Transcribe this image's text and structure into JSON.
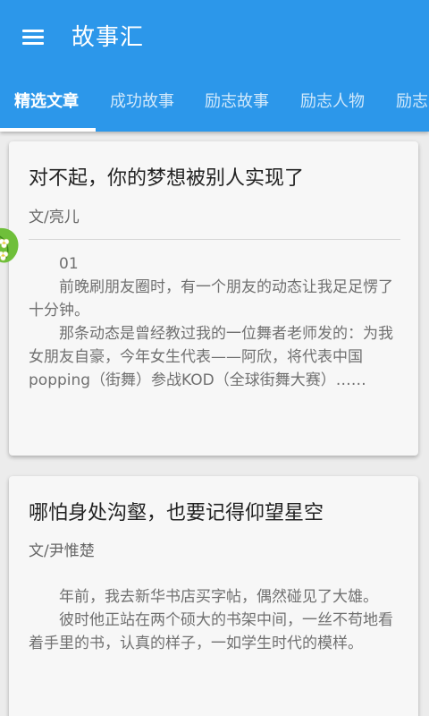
{
  "app": {
    "title": "故事汇"
  },
  "tabs": [
    {
      "label": "精选文章",
      "active": true
    },
    {
      "label": "成功故事",
      "active": false
    },
    {
      "label": "励志故事",
      "active": false
    },
    {
      "label": "励志人物",
      "active": false
    },
    {
      "label": "励志",
      "active": false
    }
  ],
  "articles": [
    {
      "title": "对不起，你的梦想被别人实现了",
      "author": "文/亮儿",
      "paragraphs": [
        "01",
        "前晚刷朋友圈时，有一个朋友的动态让我足足愣了十分钟。",
        "那条动态是曾经教过我的一位舞者老师发的：为我女朋友自豪，今年女生代表——阿欣，将代表中国popping（街舞）参战KOD（全球街舞大赛）……"
      ]
    },
    {
      "title": "哪怕身处沟壑，也要记得仰望星空",
      "author": "文/尹惟楚",
      "paragraphs": [
        "年前，我去新华书店买字帖，偶然碰见了大雄。",
        "彼时他正站在两个硕大的书架中间，一丝不苟地看着手里的书，认真的样子，一如学生时代的模样。"
      ]
    }
  ],
  "colors": {
    "primary": "#2c97ea",
    "background": "#ececec",
    "card": "#f7f7f7"
  },
  "icons": {
    "menu": "menu-icon",
    "decoration": "leaf-flower-icon"
  }
}
